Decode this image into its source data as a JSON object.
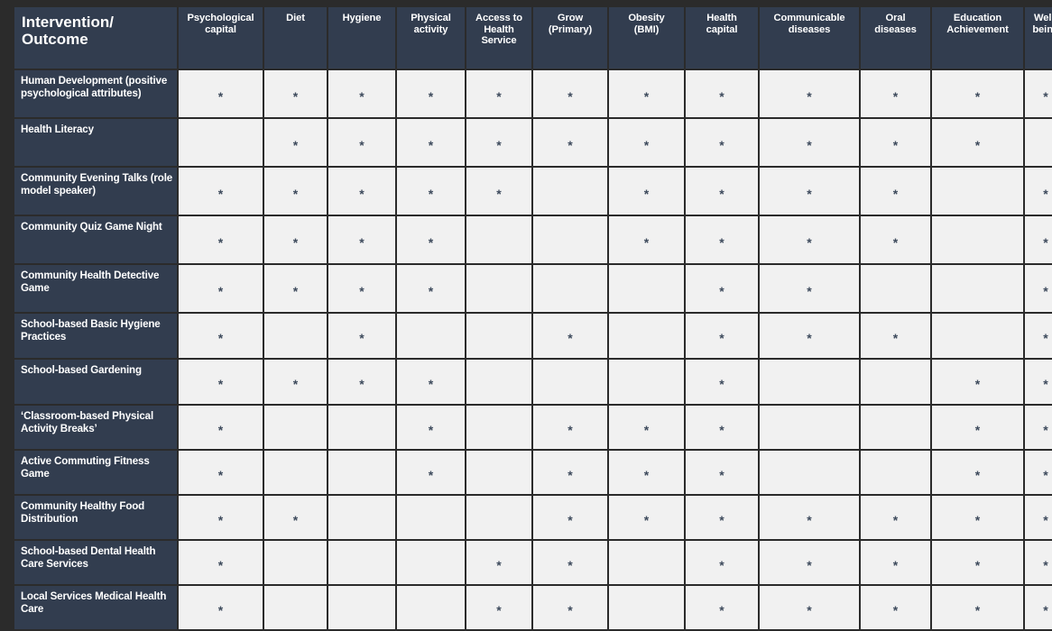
{
  "table": {
    "corner_label": "Intervention/\nOutcome",
    "columns": [
      "Psychological capital",
      "Diet",
      "Hygiene",
      "Physical activity",
      "Access to Health Service",
      "Grow (Primary)",
      "Obesity (BMI)",
      "Health capital",
      "Communicable diseases",
      "Oral diseases",
      "Education Achievement",
      "Well-being"
    ],
    "mark": "*",
    "rows": [
      {
        "label": "Human Development (positive psychological attributes)",
        "marks": [
          true,
          true,
          true,
          true,
          true,
          true,
          true,
          true,
          true,
          true,
          true,
          true
        ]
      },
      {
        "label": "Health Literacy",
        "marks": [
          false,
          true,
          true,
          true,
          true,
          true,
          true,
          true,
          true,
          true,
          true,
          false
        ]
      },
      {
        "label": "Community Evening Talks (role model speaker)",
        "marks": [
          true,
          true,
          true,
          true,
          true,
          false,
          true,
          true,
          true,
          true,
          false,
          true
        ]
      },
      {
        "label": "Community Quiz Game Night",
        "marks": [
          true,
          true,
          true,
          true,
          false,
          false,
          true,
          true,
          true,
          true,
          false,
          true
        ]
      },
      {
        "label": "Community Health Detective Game",
        "marks": [
          true,
          true,
          true,
          true,
          false,
          false,
          false,
          true,
          true,
          false,
          false,
          true
        ]
      },
      {
        "label": "School-based Basic Hygiene Practices",
        "marks": [
          true,
          false,
          true,
          false,
          false,
          true,
          false,
          true,
          true,
          true,
          false,
          true
        ]
      },
      {
        "label": "School-based Gardening",
        "marks": [
          true,
          true,
          true,
          true,
          false,
          false,
          false,
          true,
          false,
          false,
          true,
          true
        ]
      },
      {
        "label": "‘Classroom-based Physical Activity Breaks’",
        "marks": [
          true,
          false,
          false,
          true,
          false,
          true,
          true,
          true,
          false,
          false,
          true,
          true
        ]
      },
      {
        "label": "Active Commuting Fitness Game",
        "marks": [
          true,
          false,
          false,
          true,
          false,
          true,
          true,
          true,
          false,
          false,
          true,
          true
        ]
      },
      {
        "label": "Community Healthy Food Distribution",
        "marks": [
          true,
          true,
          false,
          false,
          false,
          true,
          true,
          true,
          true,
          true,
          true,
          true
        ]
      },
      {
        "label": "School-based Dental Health Care Services",
        "marks": [
          true,
          false,
          false,
          false,
          true,
          true,
          false,
          true,
          true,
          true,
          true,
          true
        ]
      },
      {
        "label": "Local Services Medical Health Care",
        "marks": [
          true,
          false,
          false,
          false,
          true,
          true,
          false,
          true,
          true,
          true,
          true,
          true
        ]
      }
    ]
  },
  "colors": {
    "header_bg": "#323d4f",
    "cell_bg": "#f1f1f1",
    "page_bg": "#2b2b2b",
    "mark_color": "#3d4a5c",
    "header_text": "#ffffff"
  }
}
